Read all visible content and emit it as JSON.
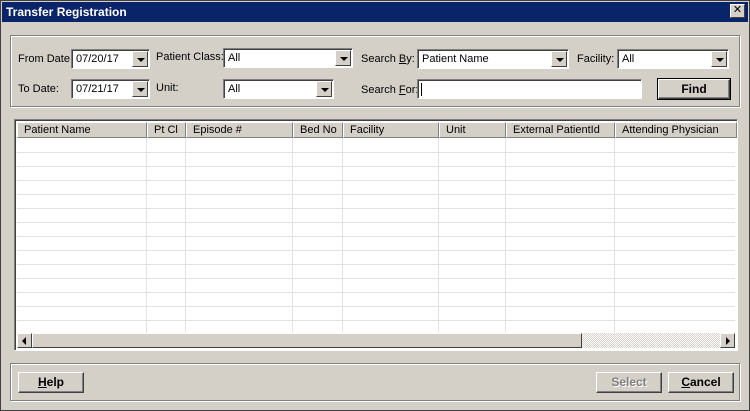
{
  "window": {
    "title": "Transfer Registration",
    "close_glyph": "✕"
  },
  "search": {
    "from_date": {
      "label": "From Date:",
      "value": "07/20/17"
    },
    "to_date": {
      "label": "To Date:",
      "value": "07/21/17"
    },
    "patient_class": {
      "label": "Patient Class:",
      "value": "All"
    },
    "unit": {
      "label": "Unit:",
      "value": "All"
    },
    "search_by": {
      "label_pre": "Search ",
      "label_key": "B",
      "label_post": "y:",
      "value": "Patient Name"
    },
    "search_for": {
      "label_pre": "Search ",
      "label_key": "F",
      "label_post": "or:",
      "value": ""
    },
    "facility": {
      "label": "Facility:",
      "value": "All"
    },
    "find_label": "Find"
  },
  "grid": {
    "columns": [
      "Patient Name",
      "Pt Cl",
      "Episode #",
      "Bed No",
      "Facility",
      "Unit",
      "External PatientId",
      "Attending Physician"
    ],
    "rows": []
  },
  "footer": {
    "help_key": "H",
    "help_rest": "elp",
    "select_label": "Select",
    "cancel_key": "C",
    "cancel_rest": "ancel"
  },
  "colors": {
    "title_bar": "#0a246a",
    "window_bg": "#d4d0c8",
    "disabled_text": "#808080"
  },
  "icons": {
    "close": "close-icon",
    "dropdown": "chevron-down-icon",
    "scroll_left": "arrow-left-icon",
    "scroll_right": "arrow-right-icon"
  }
}
